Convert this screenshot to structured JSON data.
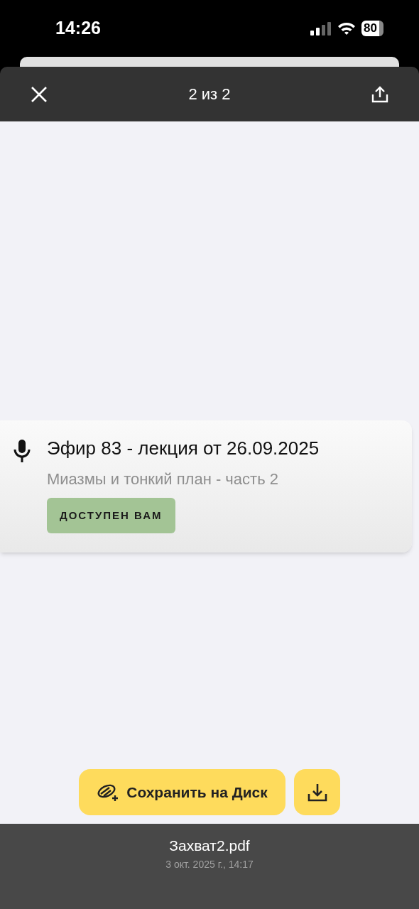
{
  "status_bar": {
    "time": "14:26",
    "battery": "80"
  },
  "toolbar": {
    "title": "2 из 2"
  },
  "document": {
    "title": "Эфир 83 - лекция от 26.09.2025",
    "subtitle": "Миазмы и тонкий план - часть 2",
    "badge": "ДОСТУПЕН ВАМ"
  },
  "actions": {
    "save": "Сохранить на Диск"
  },
  "file": {
    "name": "Захват2.pdf",
    "date": "3 окт. 2025 г., 14:17"
  }
}
